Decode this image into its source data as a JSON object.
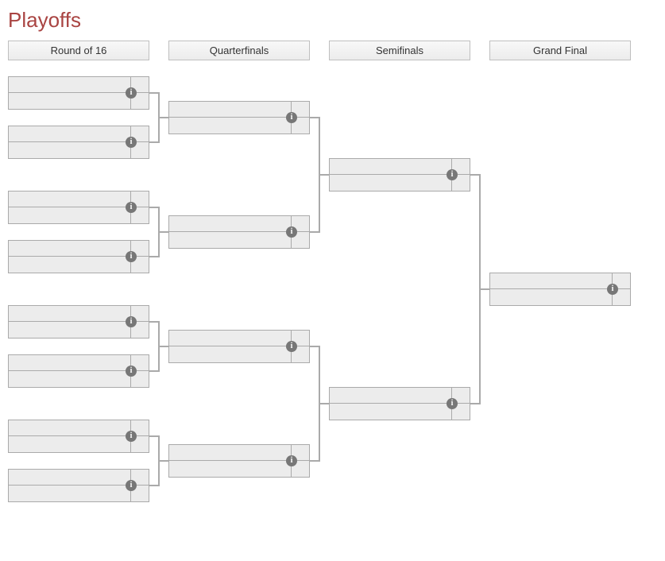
{
  "title": "Playoffs",
  "rounds": {
    "r16": "Round of 16",
    "qf": "Quarterfinals",
    "sf": "Semifinals",
    "gf": "Grand Final"
  },
  "info_glyph": "i"
}
